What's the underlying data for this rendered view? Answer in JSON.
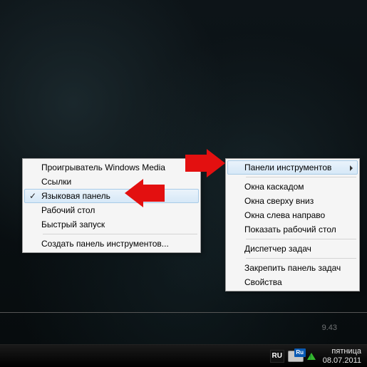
{
  "mainmenu": {
    "toolbars": "Панели инструментов",
    "cascade": "Окна каскадом",
    "stack_v": "Окна сверху вниз",
    "stack_h": "Окна слева направо",
    "show_desktop": "Показать рабочий стол",
    "task_manager": "Диспетчер задач",
    "lock": "Закрепить панель задач",
    "properties": "Свойства"
  },
  "submenu": {
    "wmp": "Проигрыватель Windows Media",
    "links": "Ссылки",
    "langbar": "Языковая панель",
    "desktop": "Рабочий стол",
    "quicklaunch": "Быстрый запуск",
    "new_toolbar": "Создать панель инструментов..."
  },
  "tray": {
    "lang_code": "RU",
    "kbd_badge": "Ru",
    "weekday": "пятница",
    "date": "08.07.2011",
    "time_peek": "9.43"
  }
}
